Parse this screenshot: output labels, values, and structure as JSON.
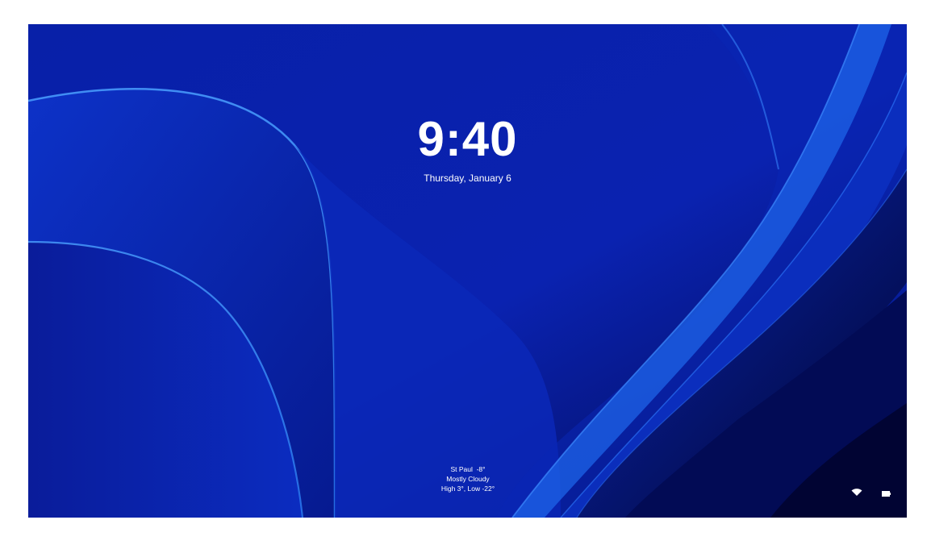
{
  "lockscreen": {
    "time": "9:40",
    "date": "Thursday, January 6",
    "background_color": "#0a1fa8"
  },
  "weather": {
    "location_temp": "St Paul  -8°",
    "condition": "Mostly Cloudy",
    "high_low": "High 3°, Low -22°"
  },
  "status_tray": {
    "icons": [
      "wifi-icon",
      "battery-icon"
    ]
  }
}
